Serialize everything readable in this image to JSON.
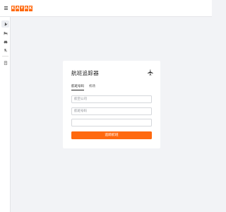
{
  "brand": {
    "logo_letters": [
      "K",
      "A",
      "Y",
      "A",
      "K"
    ],
    "accent_color": "#ff690f"
  },
  "sidebar": {
    "items": [
      {
        "icon": "plane-icon",
        "active": true
      },
      {
        "icon": "bed-icon",
        "active": false
      },
      {
        "icon": "car-icon",
        "active": false
      },
      {
        "icon": "beach-chair-icon",
        "active": false
      },
      {
        "icon": "clipboard-icon",
        "active": false
      }
    ]
  },
  "tracker": {
    "title": "航班追踪器",
    "tabs": [
      {
        "label": "航班号码",
        "active": true
      },
      {
        "label": "机场",
        "active": false
      }
    ],
    "airline_placeholder": "航空公司",
    "flight_number_placeholder": "航班号码",
    "date_value": "",
    "submit_label": "追踪航班"
  }
}
